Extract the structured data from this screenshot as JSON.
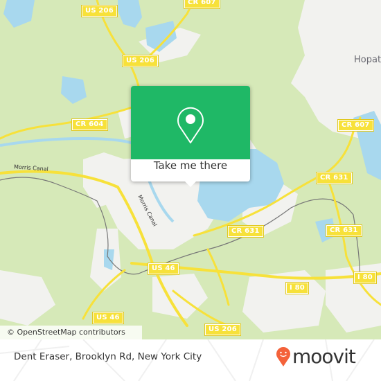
{
  "map": {
    "road_labels": [
      {
        "id": "us206-top",
        "text": "US 206"
      },
      {
        "id": "us206-mid",
        "text": "US 206"
      },
      {
        "id": "cr607-top",
        "text": "CR 607"
      },
      {
        "id": "cr604",
        "text": "CR 604"
      },
      {
        "id": "cr607-right",
        "text": "CR 607"
      },
      {
        "id": "cr631-a",
        "text": "CR 631"
      },
      {
        "id": "cr631-b",
        "text": "CR 631"
      },
      {
        "id": "cr631-c",
        "text": "CR 631"
      },
      {
        "id": "us46-a",
        "text": "US 46"
      },
      {
        "id": "us46-b",
        "text": "US 46"
      },
      {
        "id": "i80-a",
        "text": "I 80"
      },
      {
        "id": "i80-b",
        "text": "I 80"
      },
      {
        "id": "us206-bottom",
        "text": "US 206"
      }
    ],
    "place_labels": [
      {
        "text": "Hopat"
      }
    ],
    "waterway_labels": [
      {
        "text": "Morris Canal"
      },
      {
        "text": "Morris Canal"
      }
    ],
    "attribution": "© OpenStreetMap contributors",
    "colors": {
      "land": "#d6e9b8",
      "urban": "#f2f2ef",
      "water": "#a8d8ee",
      "road": "#f7e13a",
      "rail": "#777777"
    }
  },
  "popup": {
    "icon": "map-pin-icon",
    "button_label": "Take me there",
    "accent_color": "#1fb866"
  },
  "footer": {
    "address": "Dent Eraser, Brooklyn Rd, New York City",
    "logo_text": "moovit",
    "logo_icon": "moovit-pin-icon",
    "logo_color": "#f4623a"
  }
}
